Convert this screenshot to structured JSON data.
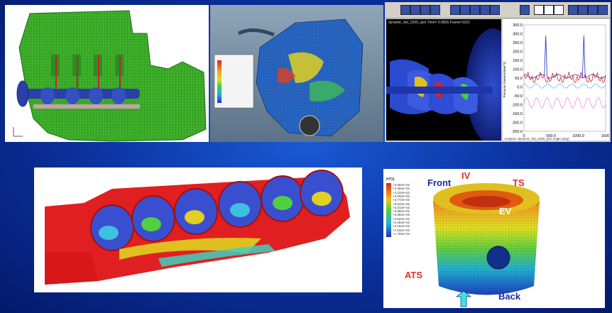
{
  "panel5_labels": {
    "front": "Front",
    "iv": "IV",
    "ts": "TS",
    "ev": "EV",
    "ats": "ATS",
    "back": "Back"
  },
  "panel5_legend": {
    "title": "HT11",
    "values": [
      "+4.692e+02",
      "+4.462e+02",
      "+4.232e+02",
      "+4.002e+02",
      "+3.772e+02",
      "+3.542e+02",
      "+3.312e+02",
      "+3.082e+02",
      "+2.852e+02",
      "+2.622e+02",
      "+2.392e+02",
      "+2.162e+02",
      "+1.932e+02",
      "+1.702e+02"
    ]
  },
  "panel3": {
    "sim_caption": "dynamic_fsd_2200_rpm  Time= 0.0826  Frame=1521",
    "footer": "Analysis: dynamic_fsd_2200_rpm  Angle (deg)",
    "y_axis_label": "Pressure (Newton/mm^2)"
  },
  "panel3_chart": {
    "chart_data": {
      "type": "line",
      "ylim": [
        -250,
        350
      ],
      "xlim": [
        0,
        1500
      ],
      "y_ticks": [
        "350.0",
        "300.0",
        "250.0",
        "200.0",
        "150.0",
        "100.0",
        "50.0",
        "0.0",
        "-50.0",
        "-100.0",
        "-150.0",
        "-200.0",
        "-250.0"
      ],
      "x_ticks": [
        "0",
        "500.0",
        "1000.0",
        "1500"
      ]
    }
  },
  "colors": {
    "background": "#0a2f9a",
    "red_label": "#e03020",
    "blue_label": "#1a2a9a"
  }
}
